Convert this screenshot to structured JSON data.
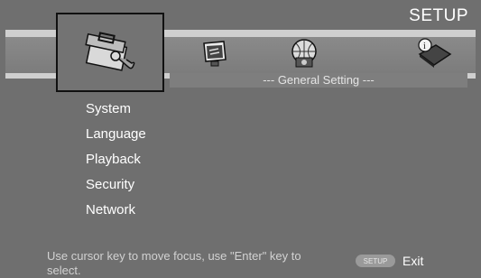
{
  "header": {
    "title": "SETUP"
  },
  "tabs": [
    {
      "name": "general",
      "icon": "toolbox-wrench-icon"
    },
    {
      "name": "display",
      "icon": "monitor-icon"
    },
    {
      "name": "audio",
      "icon": "speaker-globe-icon"
    },
    {
      "name": "information",
      "icon": "info-book-icon"
    }
  ],
  "section": {
    "subtitle": "--- General Setting ---"
  },
  "menu": {
    "items": [
      "System",
      "Language",
      "Playback",
      "Security",
      "Network"
    ]
  },
  "footer": {
    "help_text": "Use cursor key to move focus, use  \"Enter\"  key to select.",
    "setup_button_label": "SETUP",
    "exit_label": "Exit"
  }
}
